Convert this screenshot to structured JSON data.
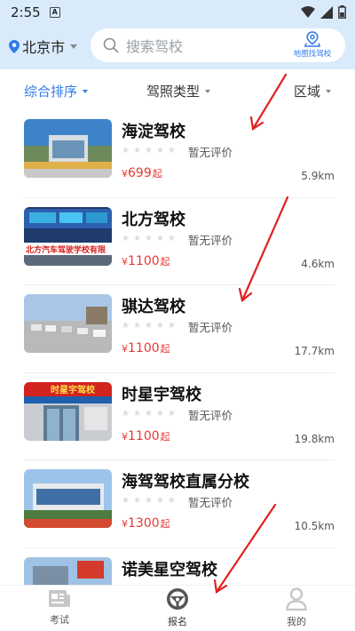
{
  "status_bar": {
    "time": "2:55",
    "notification_glyph": "A",
    "icons": [
      "wifi-icon",
      "signal-icon",
      "battery-icon"
    ]
  },
  "header": {
    "city": "北京市",
    "search_placeholder": "搜索驾校",
    "map_find_label": "地图找驾校"
  },
  "filters": [
    {
      "label": "综合排序",
      "active": true
    },
    {
      "label": "驾照类型",
      "active": false
    },
    {
      "label": "区域",
      "active": false
    }
  ],
  "schools": [
    {
      "name": "海淀驾校",
      "rating_text": "暂无评价",
      "price_symbol": "¥",
      "price": "699",
      "price_suffix": "起",
      "distance": "5.9km",
      "stars": 5
    },
    {
      "name": "北方驾校",
      "rating_text": "暂无评价",
      "price_symbol": "¥",
      "price": "1100",
      "price_suffix": "起",
      "distance": "4.6km",
      "stars": 5,
      "thumb_text": "北方汽车驾驶学校有限"
    },
    {
      "name": "骐达驾校",
      "rating_text": "暂无评价",
      "price_symbol": "¥",
      "price": "1100",
      "price_suffix": "起",
      "distance": "17.7km",
      "stars": 5
    },
    {
      "name": "时星宇驾校",
      "rating_text": "暂无评价",
      "price_symbol": "¥",
      "price": "1100",
      "price_suffix": "起",
      "distance": "19.8km",
      "stars": 5,
      "thumb_text": "时星宇驾校"
    },
    {
      "name": "海驾驾校直属分校",
      "rating_text": "暂无评价",
      "price_symbol": "¥",
      "price": "1300",
      "price_suffix": "起",
      "distance": "10.5km",
      "stars": 5
    },
    {
      "name": "诺美星空驾校",
      "rating_text": "",
      "price_symbol": "",
      "price": "",
      "price_suffix": "",
      "distance": "",
      "stars": 0
    }
  ],
  "tabbar": [
    {
      "label": "考试",
      "icon": "newspaper-icon",
      "active": false
    },
    {
      "label": "报名",
      "icon": "steering-wheel-icon",
      "active": true
    },
    {
      "label": "我的",
      "icon": "person-icon",
      "active": false
    }
  ],
  "colors": {
    "accent": "#2f7bea",
    "price": "#e53935",
    "header_bg": "#d9ebfb",
    "annotation_arrow": "#e02020"
  }
}
